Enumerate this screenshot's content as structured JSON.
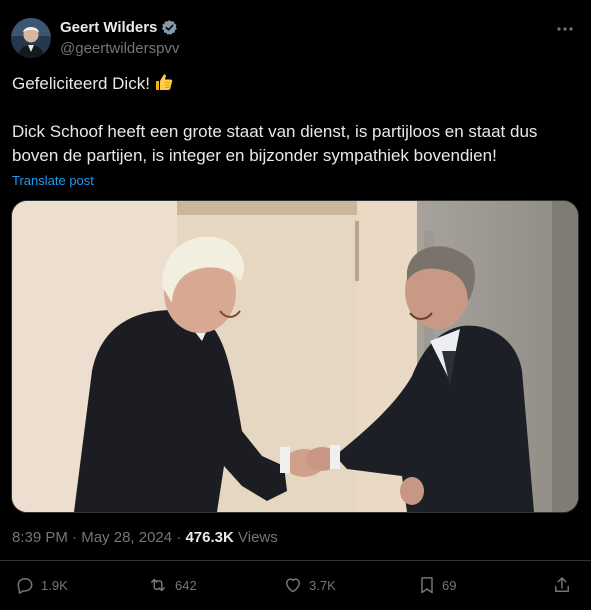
{
  "author": {
    "name": "Geert Wilders",
    "handle": "@geertwilderspvv"
  },
  "post": {
    "line1": "Gefeliciteerd Dick!",
    "line1_emoji": "thumbs-up-emoji",
    "line2": "Dick Schoof heeft een grote staat van dienst, is partijloos en staat dus boven de partijen, is integer en bijzonder sympathiek bovendien!",
    "translate_label": "Translate post",
    "media_alt": "Two men in dark suits shaking hands and smiling in a hallway"
  },
  "meta": {
    "time": "8:39 PM",
    "separator": "·",
    "date": "May 28, 2024",
    "views_count": "476.3K",
    "views_label": "Views"
  },
  "actions": {
    "replies": "1.9K",
    "reposts": "642",
    "likes": "3.7K",
    "bookmarks": "69"
  },
  "colors": {
    "background": "#000000",
    "text": "#e7e9ea",
    "muted": "#71767b",
    "link": "#1d9bf0",
    "verified": "#829aab"
  },
  "icons": [
    "verified-badge-icon",
    "more-icon",
    "reply-icon",
    "repost-icon",
    "like-icon",
    "bookmark-icon",
    "share-icon"
  ]
}
